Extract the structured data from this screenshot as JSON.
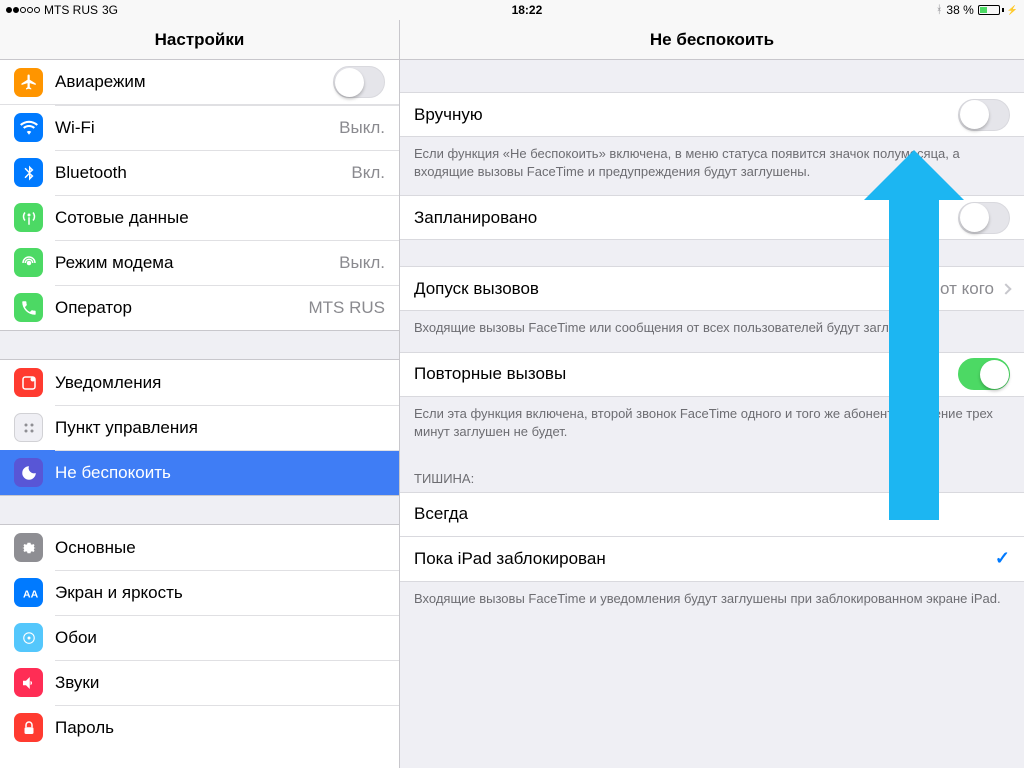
{
  "status": {
    "carrier": "MTS RUS",
    "net": "3G",
    "time": "18:22",
    "bt": "",
    "batt_pct": "38 %"
  },
  "left_title": "Настройки",
  "right_title": "Не беспокоить",
  "sidebar": {
    "airplane": "Авиарежим",
    "wifi": "Wi-Fi",
    "wifi_val": "Выкл.",
    "bt": "Bluetooth",
    "bt_val": "Вкл.",
    "cell": "Сотовые данные",
    "hotspot": "Режим модема",
    "hotspot_val": "Выкл.",
    "carrier": "Оператор",
    "carrier_val": "MTS RUS",
    "notif": "Уведомления",
    "control": "Пункт управления",
    "dnd": "Не беспокоить",
    "general": "Основные",
    "display": "Экран и яркость",
    "wall": "Обои",
    "sound": "Звуки",
    "pass": "Пароль"
  },
  "main": {
    "manual": "Вручную",
    "manual_note": "Если функция «Не беспокоить» включена, в меню статуса появится значок полумесяца, а входящие вызовы FaceTime и предупреждения будут заглушены.",
    "scheduled": "Запланировано",
    "allow": "Допуск вызовов",
    "allow_val": "Ни от кого",
    "allow_note": "Входящие вызовы FaceTime или сообщения от всех пользователей будут заглушены.",
    "repeat": "Повторные вызовы",
    "repeat_note": "Если эта функция включена, второй звонок FaceTime одного и того же абонента в течение трех минут заглушен не будет.",
    "silence_hdr": "ТИШИНА:",
    "always": "Всегда",
    "locked": "Пока iPad заблокирован",
    "locked_note": "Входящие вызовы FaceTime и уведомления будут заглушены при заблокированном экране iPad."
  }
}
